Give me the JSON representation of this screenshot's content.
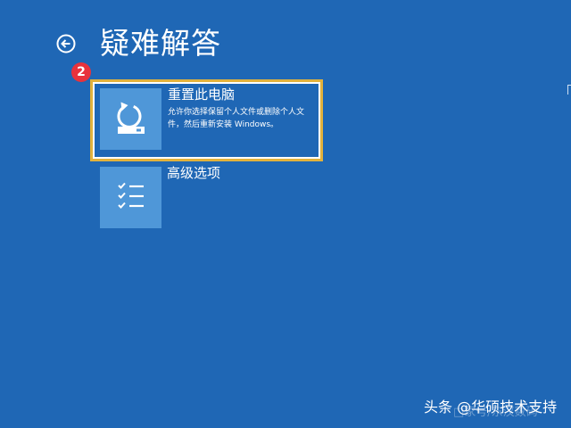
{
  "header": {
    "title": "疑难解答",
    "back_icon": "arrow-left-circle-icon"
  },
  "annotation": {
    "step_number": "2",
    "badge_color": "#e8323c"
  },
  "options": {
    "reset": {
      "title": "重置此电脑",
      "description": "允许你选择保留个人文件或删除个人文件，然后重新安装 Windows。",
      "icon": "reset-pc-icon",
      "selected": true,
      "highlight_color": "#e2b23c"
    },
    "advanced": {
      "title": "高级选项",
      "icon": "checklist-icon"
    }
  },
  "watermark": {
    "text": "头条 @华硕技术支持",
    "faint_text": "□家号/东汉数码"
  },
  "colors": {
    "background": "#1f67b5",
    "tile": "#4f97d8",
    "text": "#ffffff"
  }
}
